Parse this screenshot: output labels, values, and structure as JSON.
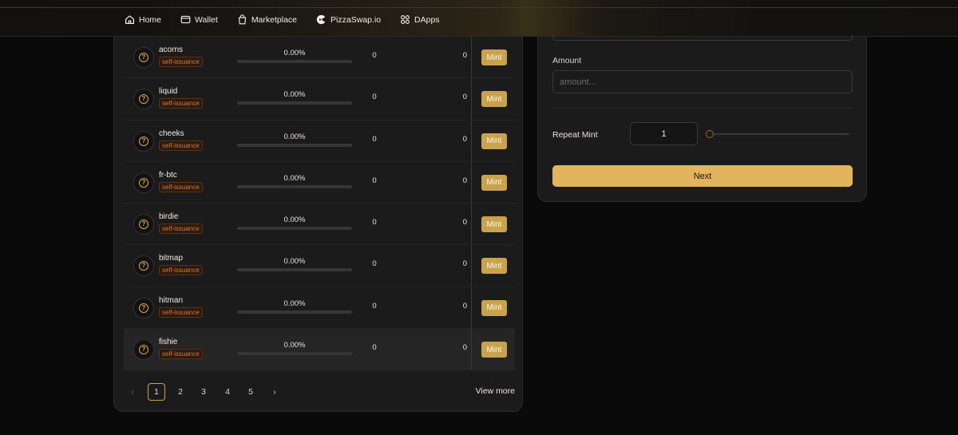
{
  "nav": {
    "items": [
      {
        "label": "Home",
        "icon": "home-icon"
      },
      {
        "label": "Wallet",
        "icon": "wallet-icon"
      },
      {
        "label": "Marketplace",
        "icon": "bag-icon"
      },
      {
        "label": "PizzaSwap.io",
        "icon": "pizzaswap-icon"
      },
      {
        "label": "DApps",
        "icon": "dapps-icon"
      }
    ]
  },
  "tokens": [
    {
      "name": "acorns",
      "badge": "self-issuance",
      "progress_text": "0.00%",
      "progress": 0,
      "holders": "0",
      "txs": "0",
      "mint_label": "Mint"
    },
    {
      "name": "liquid",
      "badge": "self-issuance",
      "progress_text": "0.00%",
      "progress": 0,
      "holders": "0",
      "txs": "0",
      "mint_label": "Mint"
    },
    {
      "name": "cheeks",
      "badge": "self-issuance",
      "progress_text": "0.00%",
      "progress": 0,
      "holders": "0",
      "txs": "0",
      "mint_label": "Mint"
    },
    {
      "name": "fr-btc",
      "badge": "self-issuance",
      "progress_text": "0.00%",
      "progress": 0,
      "holders": "0",
      "txs": "0",
      "mint_label": "Mint"
    },
    {
      "name": "birdie",
      "badge": "self-issuance",
      "progress_text": "0.00%",
      "progress": 0,
      "holders": "0",
      "txs": "0",
      "mint_label": "Mint"
    },
    {
      "name": "bitmap",
      "badge": "self-issuance",
      "progress_text": "0.00%",
      "progress": 0,
      "holders": "0",
      "txs": "0",
      "mint_label": "Mint"
    },
    {
      "name": "hitman",
      "badge": "self-issuance",
      "progress_text": "0.00%",
      "progress": 0,
      "holders": "0",
      "txs": "0",
      "mint_label": "Mint"
    },
    {
      "name": "fishie",
      "badge": "self-issuance",
      "progress_text": "0.00%",
      "progress": 0,
      "holders": "0",
      "txs": "0",
      "mint_label": "Mint"
    }
  ],
  "pagination": {
    "prev": "‹",
    "next": "›",
    "pages": [
      "1",
      "2",
      "3",
      "4",
      "5"
    ],
    "current": "1",
    "view_more": "View more"
  },
  "mint_form": {
    "amount_label": "Amount",
    "amount_placeholder": "amount...",
    "repeat_label": "Repeat Mint",
    "repeat_value": "1",
    "repeat_slider": 0,
    "next_label": "Next"
  },
  "colors": {
    "accent": "#e2b45c",
    "mint_button": "#c9a24c",
    "badge_text": "#d77a2f",
    "panel_bg": "#1b1b1c",
    "page_bg": "#0b0a0a"
  }
}
